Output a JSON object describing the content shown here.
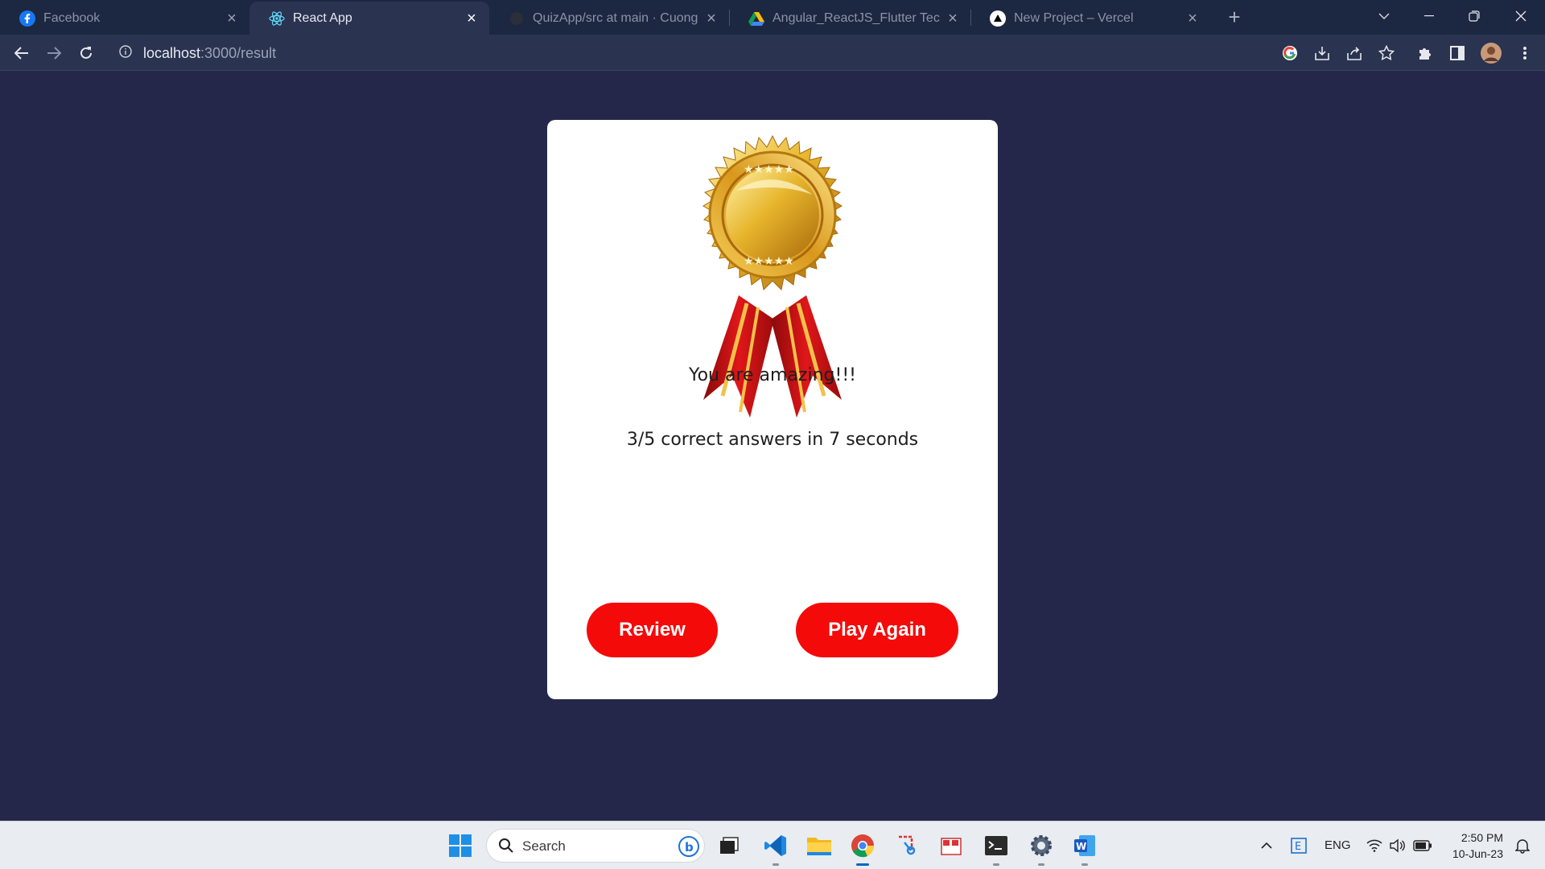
{
  "browser": {
    "tabs": [
      {
        "title": "Facebook",
        "icon": "facebook-icon",
        "active": false
      },
      {
        "title": "React App",
        "icon": "react-icon",
        "active": true
      },
      {
        "title": "QuizApp/src at main · CuongGos",
        "icon": "github-icon",
        "active": false
      },
      {
        "title": "Angular_ReactJS_Flutter Technical",
        "icon": "google-drive-icon",
        "active": false
      },
      {
        "title": "New Project – Vercel",
        "icon": "vercel-icon",
        "active": false
      }
    ],
    "url": {
      "host": "localhost",
      "rest": ":3000/result"
    }
  },
  "result": {
    "message": "You are amazing!!!",
    "summary": "3/5 correct answers in 7 seconds",
    "review_label": "Review",
    "play_again_label": "Play Again"
  },
  "taskbar": {
    "search_placeholder": "Search",
    "language": "ENG",
    "time": "2:50 PM",
    "date": "10-Jun-23"
  },
  "colors": {
    "page_background": "#25274a",
    "button_red": "#f50a0a",
    "card": "#ffffff"
  }
}
